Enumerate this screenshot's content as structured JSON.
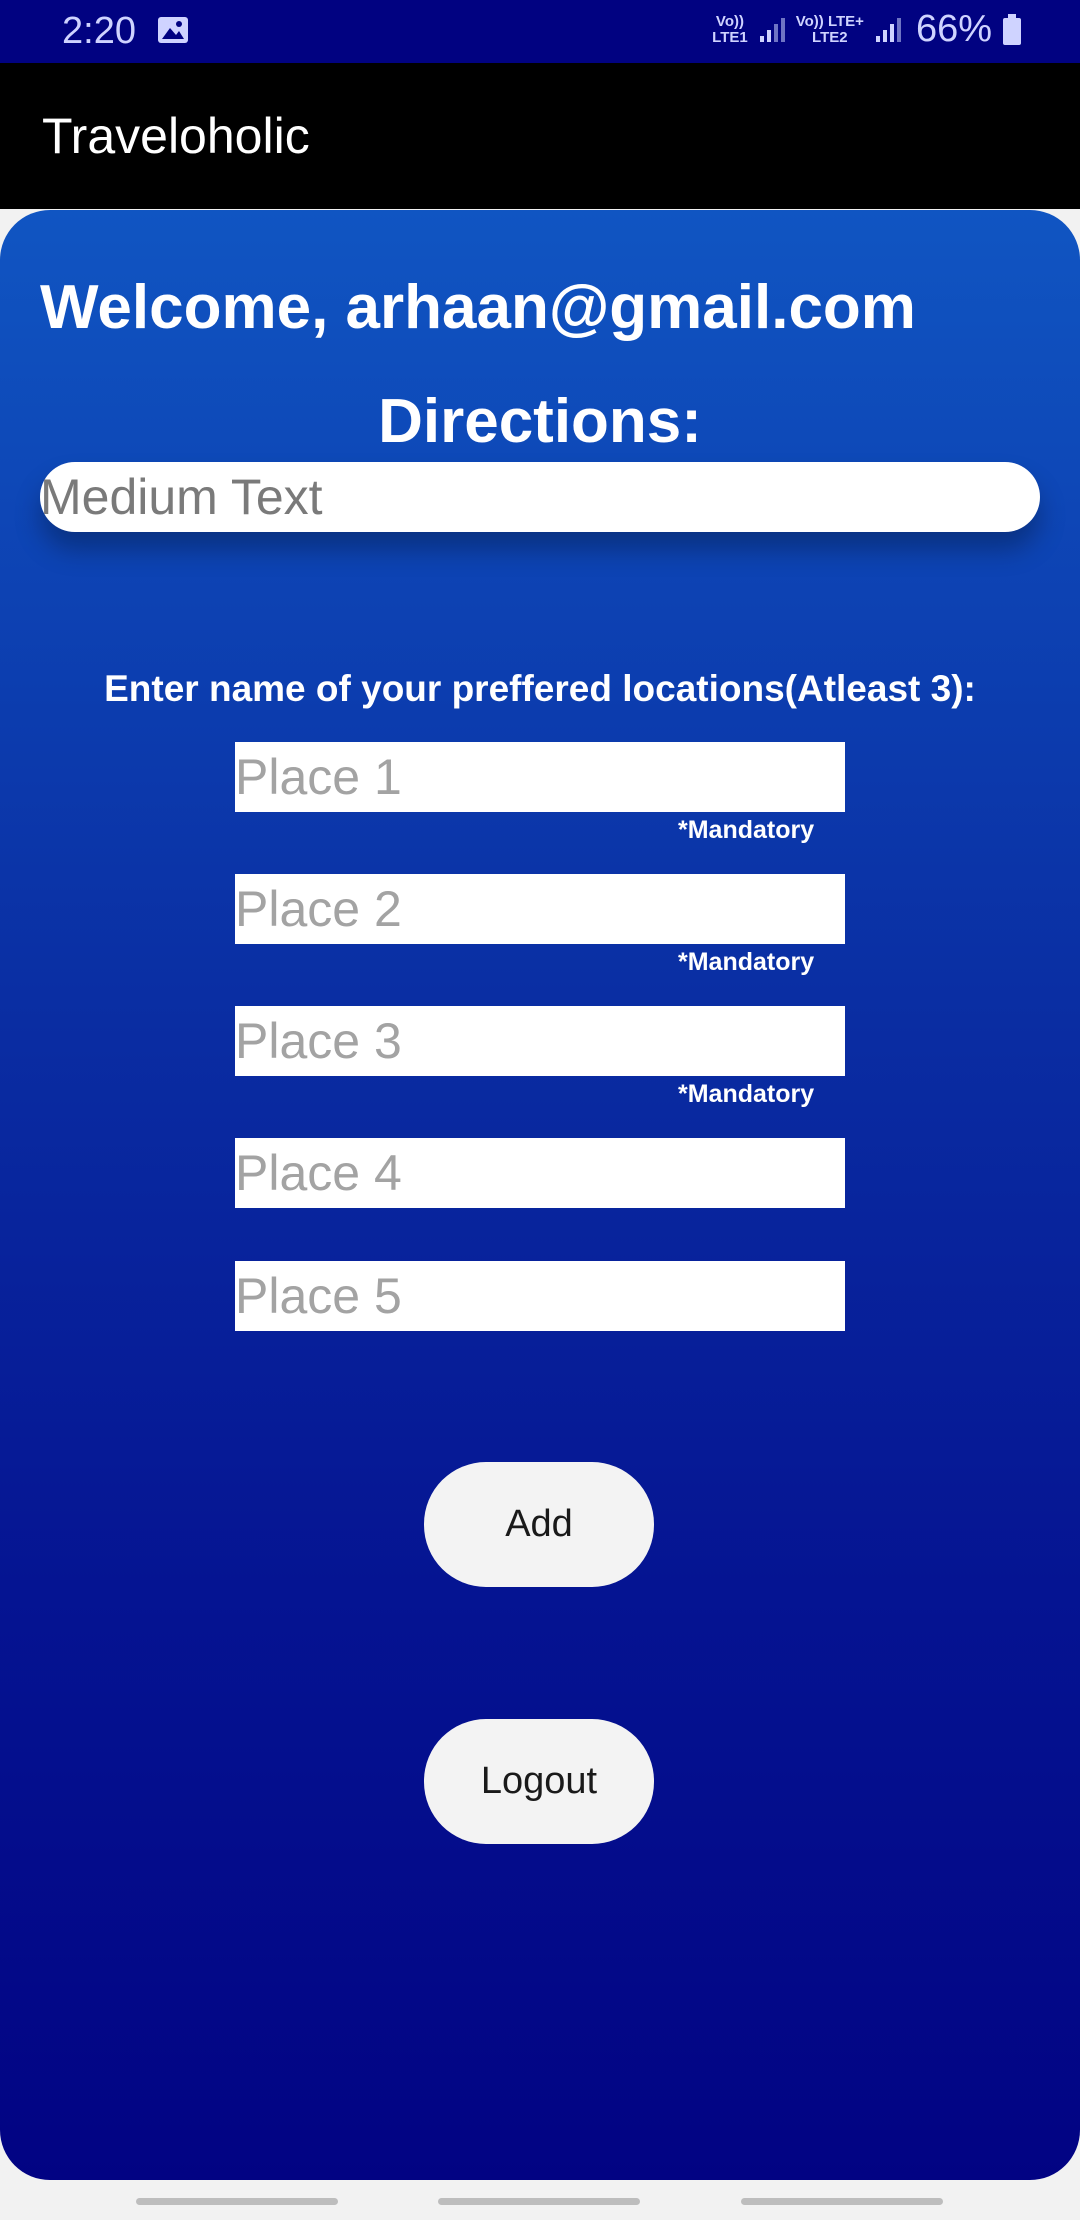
{
  "status_bar": {
    "time": "2:20",
    "sim1_top": "Vo))",
    "sim1_bottom": "LTE1",
    "sim2_top": "Vo)) LTE+",
    "sim2_bottom": "LTE2",
    "battery_percent": "66%",
    "icons": [
      "gallery-icon",
      "signal-icon",
      "battery-icon"
    ]
  },
  "app_bar": {
    "title": "Traveloholic"
  },
  "main": {
    "welcome_text": "Welcome, arhaan@gmail.com",
    "directions_label": "Directions:",
    "directions_text": "Medium Text",
    "locations_label": "Enter name of your preffered locations(Atleast 3):",
    "places": [
      {
        "placeholder": "Place 1",
        "note": "*Mandatory"
      },
      {
        "placeholder": "Place 2",
        "note": "*Mandatory"
      },
      {
        "placeholder": "Place 3",
        "note": "*Mandatory"
      },
      {
        "placeholder": "Place 4"
      },
      {
        "placeholder": "Place 5"
      }
    ],
    "add_button": "Add",
    "logout_button": "Logout"
  },
  "colors": {
    "status_bar_bg": "#010281",
    "app_bar_bg": "#000000",
    "gradient_top": "#1055c2",
    "gradient_bottom": "#020383",
    "button_bg": "#f3f3f3"
  }
}
